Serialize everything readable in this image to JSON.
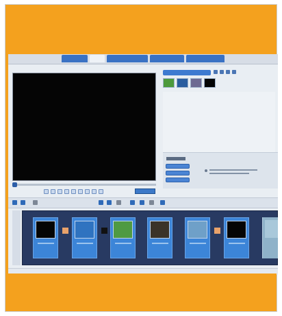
{
  "menu": {
    "items": [
      "",
      "",
      "",
      ""
    ]
  },
  "tabs": [
    {
      "label": "",
      "color": "#3a72c4"
    },
    {
      "label": "",
      "color": "#d8dfe8"
    },
    {
      "label": "",
      "color": "#3a72c4"
    },
    {
      "label": "",
      "color": "#3a72c4"
    },
    {
      "label": "",
      "color": "#3a72c4"
    }
  ],
  "library": {
    "thumbs": [
      {
        "name": "green-landscape",
        "color": "#4d9a3c"
      },
      {
        "name": "blue-scene",
        "color": "#2a5d9f"
      },
      {
        "name": "people-scene",
        "color": "#6d6a92"
      },
      {
        "name": "black-clip",
        "color": "#050505"
      }
    ]
  },
  "storyboard": {
    "clips": [
      {
        "name": "clip-black",
        "image": "#050505"
      },
      {
        "name": "clip-blue-sky",
        "image": "#2f73c0"
      },
      {
        "name": "clip-green-field",
        "image": "#4f9a42"
      },
      {
        "name": "clip-dark-photo",
        "image": "#3b3327"
      },
      {
        "name": "clip-landscape",
        "image": "#6fa0c8"
      },
      {
        "name": "clip-black-2",
        "image": "#050505"
      }
    ],
    "transition_colors": [
      "#e8a26b",
      "#111111",
      "#e8a26b"
    ]
  },
  "colors": {
    "accent": "#f4a11e",
    "storyboard": "#283a62",
    "clip": "#3c85d8"
  }
}
